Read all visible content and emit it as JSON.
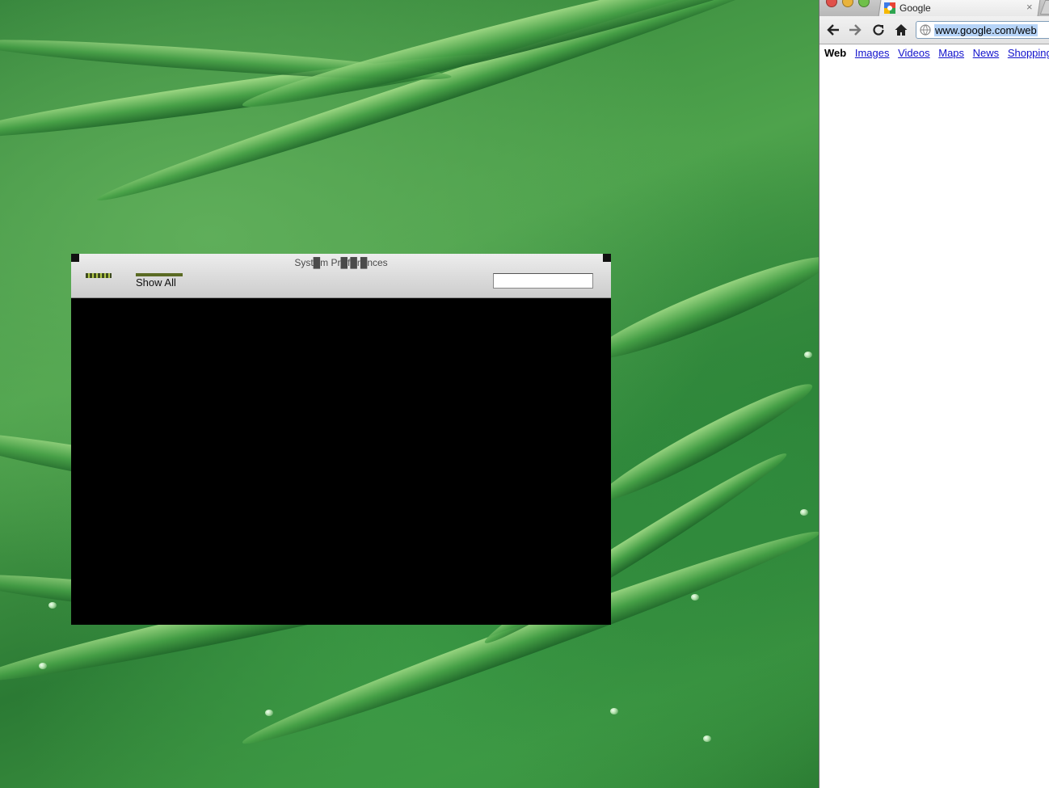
{
  "syspref": {
    "title": "Syst█m Pr█f█r█nces",
    "show_all": "Show All",
    "search_value": ""
  },
  "browser": {
    "tab_title": "Google",
    "tab_close": "×",
    "url": "www.google.com/web",
    "nav": {
      "web": "Web",
      "images": "Images",
      "videos": "Videos",
      "maps": "Maps",
      "news": "News",
      "shopping": "Shopping"
    }
  },
  "colors": {
    "link": "#1111cc",
    "url_highlight": "#b5d3f7",
    "syspref_content": "#000000"
  }
}
